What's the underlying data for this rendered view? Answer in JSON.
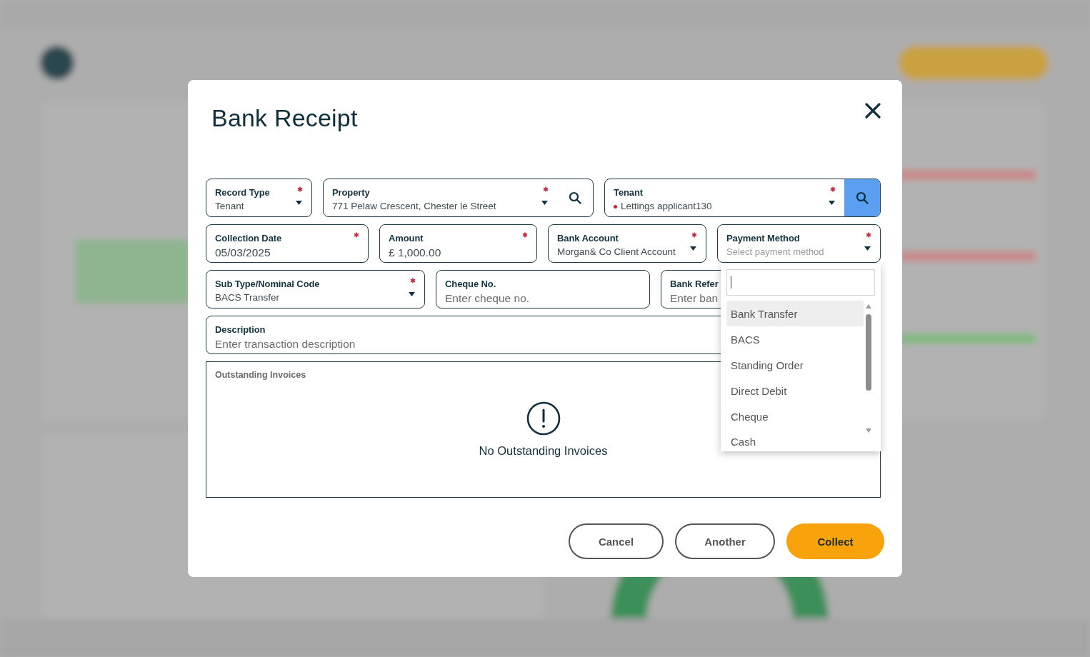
{
  "dialog": {
    "title": "Bank Receipt",
    "rows": [
      [
        {
          "kind": "select",
          "label": "Record Type",
          "value": "Tenant",
          "required": true
        },
        {
          "kind": "select",
          "label": "Property",
          "value": "771 Pelaw Crescent, Chester le Street",
          "required": true,
          "search_button": true,
          "search_highlighted": false
        },
        {
          "kind": "select",
          "label": "Tenant",
          "value": "Lettings applicant130",
          "color": "#c0283f",
          "required": true,
          "search_button": true,
          "search_highlighted": true
        }
      ],
      [
        {
          "kind": "text",
          "label": "Collection Date",
          "value": "05/03/2025",
          "required": true
        },
        {
          "kind": "text",
          "label": "Amount",
          "value": "£ 1,000.00",
          "required": true
        },
        {
          "kind": "select",
          "label": "Bank Account",
          "value": "Morgan& Co Client Account",
          "required": true
        },
        {
          "kind": "select",
          "label": "Payment Method",
          "placeholder": "Select payment method",
          "required": true
        }
      ],
      [
        {
          "kind": "select",
          "label": "Sub Type/Nominal Code",
          "value": "BACS Transfer",
          "required": true
        },
        {
          "kind": "text",
          "label": "Cheque No.",
          "placeholder": "Enter cheque no.",
          "required": false
        },
        {
          "kind": "text",
          "label": "Bank Refer",
          "placeholder": "Enter ban",
          "required": false
        }
      ],
      [
        {
          "kind": "text",
          "label": "Description",
          "placeholder": "Enter transaction description",
          "required": false
        }
      ]
    ],
    "dropdown": {
      "options": [
        {
          "label": "Bank Transfer",
          "selected": true
        },
        {
          "label": "BACS",
          "selected": false
        },
        {
          "label": "Standing Order",
          "selected": false
        },
        {
          "label": "Direct Debit",
          "selected": false
        },
        {
          "label": "Cheque",
          "selected": false
        },
        {
          "label": "Cash",
          "selected": false
        }
      ]
    },
    "invoices": {
      "title": "Outstanding Invoices",
      "empty_message": "No Outstanding Invoices"
    },
    "buttons": [
      {
        "label": "Cancel",
        "kind": "outline"
      },
      {
        "label": "Another",
        "kind": "outline"
      },
      {
        "label": "Collect",
        "kind": "primary"
      }
    ]
  }
}
